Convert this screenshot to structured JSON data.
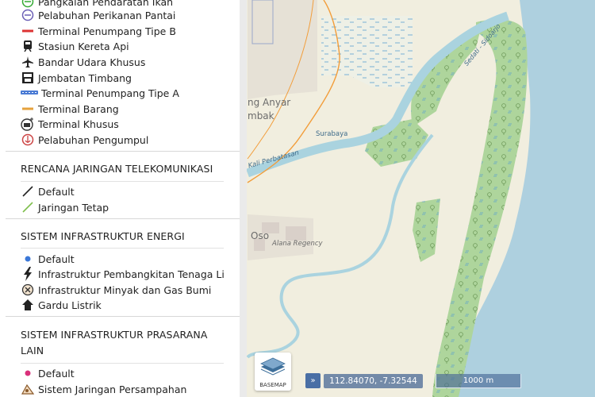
{
  "colors": {
    "sea": "#aed0df",
    "land": "#f1eedf",
    "mangrove": "#aed59c",
    "river": "#aad3df",
    "rail": "#f29d3a"
  },
  "map": {
    "place_labels": [
      "ng Anyar",
      "mbak",
      "Oso",
      "Alana Regency"
    ],
    "waterway_labels": [
      "Surabaya",
      "Kali Perbatasan",
      "Sedati - Sidoarjo"
    ]
  },
  "legend": {
    "group1": [
      {
        "icon": "fishing-landing-icon",
        "label": "Pangkalan Pendaratan Ikan"
      },
      {
        "icon": "coastal-fishing-port-icon",
        "label": "Pelabuhan Perikanan Pantai"
      },
      {
        "icon": "terminal-b-icon",
        "label": "Terminal Penumpang Tipe B"
      },
      {
        "icon": "train-icon",
        "label": "Stasiun Kereta Api"
      },
      {
        "icon": "airplane-icon",
        "label": "Bandar Udara Khusus"
      },
      {
        "icon": "weighbridge-icon",
        "label": "Jembatan Timbang"
      },
      {
        "icon": "terminal-a-icon",
        "label": "Terminal Penumpang Tipe A"
      },
      {
        "icon": "cargo-terminal-icon",
        "label": "Terminal Barang"
      },
      {
        "icon": "special-terminal-icon",
        "label": "Terminal Khusus"
      },
      {
        "icon": "collector-port-icon",
        "label": "Pelabuhan Pengumpul"
      }
    ],
    "telekomunikasi": {
      "title": "RENCANA JARINGAN TELEKOMUNIKASI",
      "items": [
        {
          "icon": "default-line-icon",
          "label": "Default"
        },
        {
          "icon": "fixed-network-line-icon",
          "label": "Jaringan Tetap"
        }
      ]
    },
    "energi": {
      "title": "SISTEM INFRASTRUKTUR ENERGI",
      "items": [
        {
          "icon": "default-dot-icon",
          "label": "Default"
        },
        {
          "icon": "lightning-icon",
          "label": "Infrastruktur Pembangkitan Tenaga Listrik"
        },
        {
          "icon": "oil-gas-icon",
          "label": "Infrastruktur Minyak dan Gas Bumi"
        },
        {
          "icon": "substation-icon",
          "label": "Gardu Listrik"
        }
      ]
    },
    "prasarana": {
      "title": "SISTEM INFRASTRUKTUR PRASARANA LAIN",
      "items": [
        {
          "icon": "default-dot-pink-icon",
          "label": "Default"
        },
        {
          "icon": "waste-system-icon",
          "label": "Sistem Jaringan Persampahan"
        }
      ]
    }
  },
  "controls": {
    "basemap_label": "BASEMAP",
    "expand_symbol": "»",
    "coordinates": "112.84070, -7.32544",
    "scale": "1000 m"
  }
}
